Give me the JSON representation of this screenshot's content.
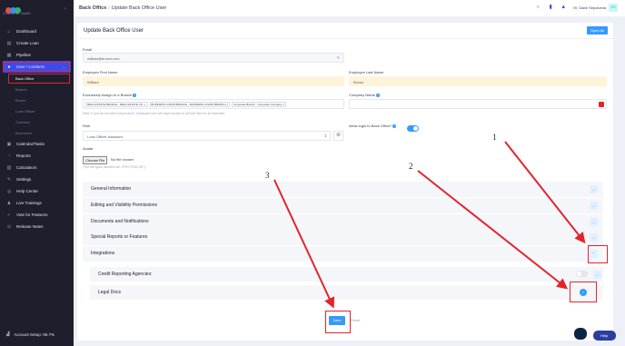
{
  "sidebar": {
    "logo_text": "COMPANY NAME",
    "items": [
      {
        "label": "Dashboard",
        "icon": "home-icon"
      },
      {
        "label": "Create Loan",
        "icon": "document-icon"
      },
      {
        "label": "Pipeline",
        "icon": "pipeline-icon"
      },
      {
        "label": "User / Contacts",
        "icon": "user-icon"
      }
    ],
    "sub_items": [
      "Back Office",
      "Branch",
      "Broker",
      "Loan Officer",
      "Contacts",
      "Borrowers"
    ],
    "items2": [
      {
        "label": "Calendar/Tasks",
        "icon": "calendar-icon"
      },
      {
        "label": "Reports",
        "icon": "reports-icon"
      },
      {
        "label": "Calculators",
        "icon": "calculator-icon"
      },
      {
        "label": "Settings",
        "icon": "gear-icon"
      },
      {
        "label": "Help Center",
        "icon": "help-icon"
      },
      {
        "label": "Live Trainings",
        "icon": "training-icon"
      },
      {
        "label": "Vote for Features",
        "icon": "vote-icon"
      },
      {
        "label": "Release Notes",
        "icon": "notes-icon"
      }
    ],
    "account": "Account Setup: 96.7%"
  },
  "topbar": {
    "crumb_root": "Back Office",
    "crumb_sep": "/",
    "crumb_page": "Update Back Office User",
    "user_name": "Hi, Gabe Sepulveda",
    "avatar": "GS"
  },
  "card": {
    "title": "Update Back Office User",
    "open_all": "Open All"
  },
  "form": {
    "email_label": "Email",
    "email_value": "william@brown.com",
    "first_name_label": "Employee First Name",
    "first_name_value": "William",
    "last_name_label": "Employee Last Name",
    "last_name_value": "Brown",
    "assign_label": "Exclusively Assign to a Branch",
    "branch_tags": [
      "REAL ESTATE BRANCH - REAL ESTATE CO. ×",
      "BUSINESS LOANS BRANCH - BUSINESS LOANS BRANCH ×",
      "Corporate Branch - Corporate Company ×"
    ],
    "assign_help": "Note: If you do not select any branch, employee user will have access to all loan files for all branches.",
    "company_label": "Company Name",
    "role_label": "Role",
    "role_value": "Loan Officer Assistant",
    "allow_login_label": "Allow login to Back Office?",
    "avatar_label": "Avatar",
    "choose_file": "Choose File",
    "no_file": "No file chosen",
    "file_help": "(The file types allowed are: JPEG,PNG,GIF.)"
  },
  "sections": [
    "General Information",
    "Editing and Visibility Permissions",
    "Documents and Notifications",
    "Special Reports or Features",
    "Integrations"
  ],
  "integrations": {
    "credit": "Credit Reporting Agencies:",
    "legal": "Legal Docs"
  },
  "buttons": {
    "save": "Save",
    "cancel": "Reset"
  },
  "widgets": {
    "help": "Help"
  },
  "annotations": {
    "one": "1",
    "two": "2",
    "three": "3"
  },
  "colors": {
    "accent": "#3699ff",
    "sidebar": "#1e1e2d",
    "active": "#3a4bf0",
    "highlight": "#e3242b"
  }
}
